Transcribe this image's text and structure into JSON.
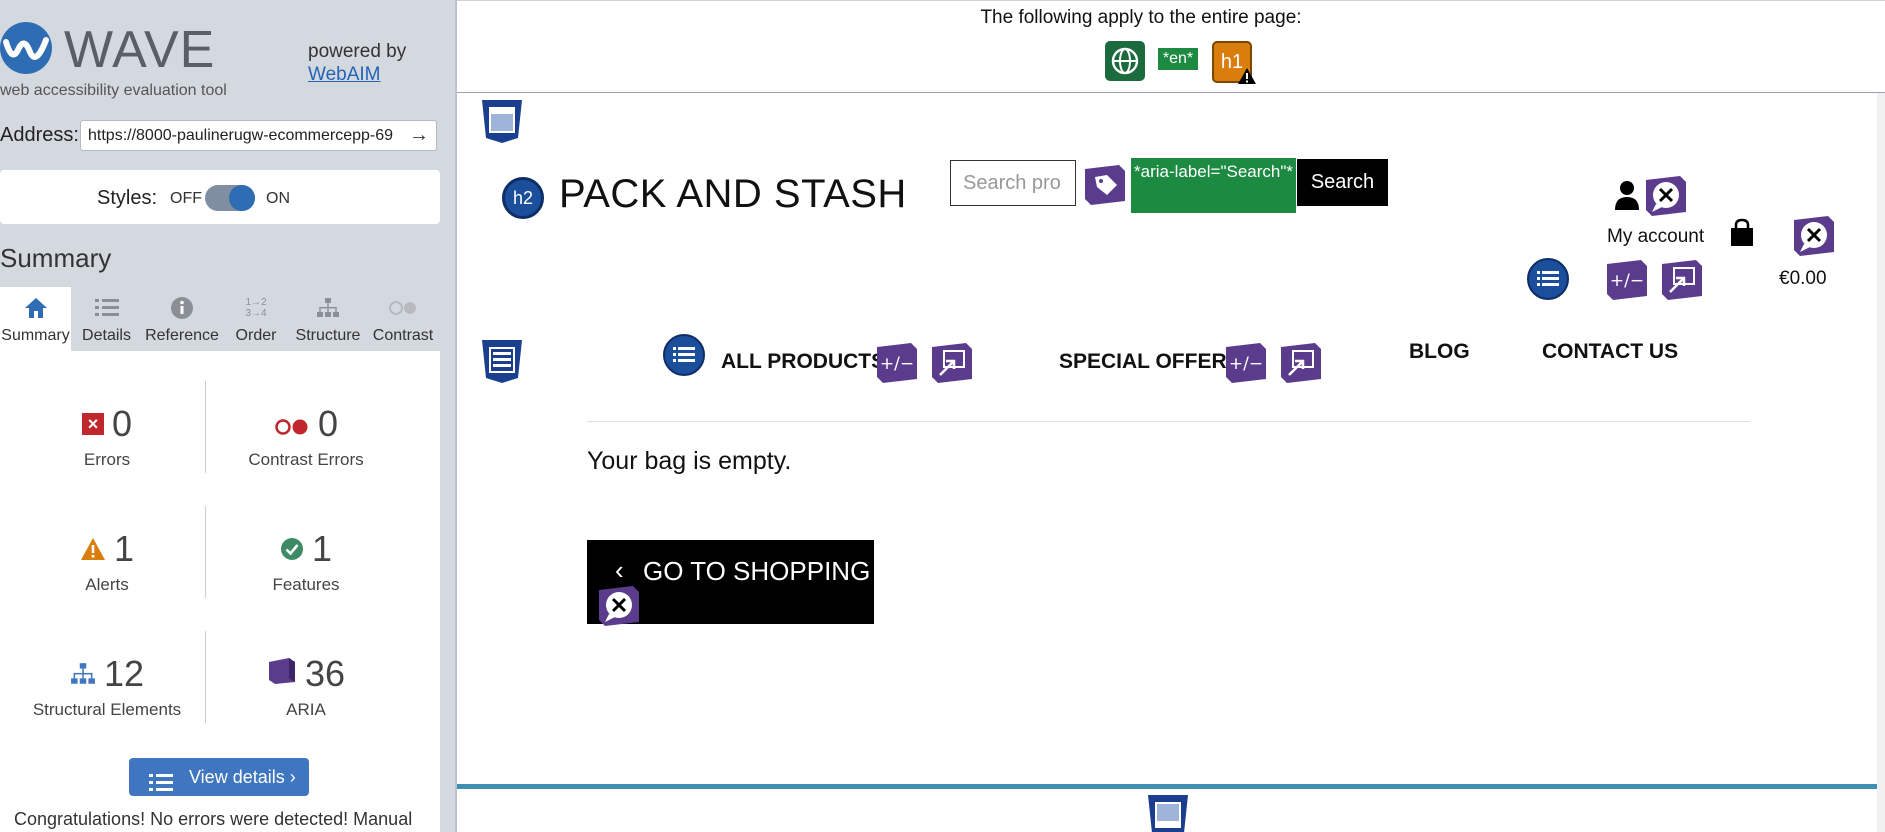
{
  "wave": {
    "logo_text": "WAVE",
    "tagline": "web accessibility evaluation tool",
    "powered_by": "powered by",
    "powered_link": "WebAIM",
    "address_label": "Address:",
    "address_value": "https://8000-paulinerugw-ecommercepp-69",
    "styles_label": "Styles:",
    "styles_off": "OFF",
    "styles_on": "ON",
    "summary_heading": "Summary",
    "tabs": [
      {
        "label": "Summary",
        "icon": "home-icon"
      },
      {
        "label": "Details",
        "icon": "list-icon"
      },
      {
        "label": "Reference",
        "icon": "info-icon"
      },
      {
        "label": "Order",
        "icon": "order-icon"
      },
      {
        "label": "Structure",
        "icon": "structure-icon"
      },
      {
        "label": "Contrast",
        "icon": "contrast-icon"
      }
    ],
    "stats": {
      "errors": {
        "count": "0",
        "label": "Errors"
      },
      "contrast": {
        "count": "0",
        "label": "Contrast Errors"
      },
      "alerts": {
        "count": "1",
        "label": "Alerts"
      },
      "features": {
        "count": "1",
        "label": "Features"
      },
      "structural": {
        "count": "12",
        "label": "Structural Elements"
      },
      "aria": {
        "count": "36",
        "label": "ARIA"
      }
    },
    "view_details": "View details ›",
    "congrats": "Congratulations! No errors were detected! Manual"
  },
  "page_banner": {
    "title": "The following apply to the entire page:",
    "lang_badge": "*en*",
    "h1_badge": "h1"
  },
  "site": {
    "h2_badge": "h2",
    "brand": "PACK AND STASH",
    "search_placeholder": "Search pro",
    "aria_note": "*aria-label=\"Search\"*",
    "search_button": "Search",
    "my_account": "My account",
    "bag_total": "€0.00",
    "nav": {
      "all_products": "ALL PRODUCTS",
      "special_offers": "SPECIAL OFFERS",
      "blog": "BLOG",
      "contact": "CONTACT US"
    },
    "bag_empty": "Your bag is empty.",
    "go_shopping": "GO TO SHOPPING",
    "aria_toggle": "+/−"
  },
  "colors": {
    "wave_blue": "#2e6db4",
    "aria_purple": "#5b3c8c",
    "feature_green": "#1c8a41",
    "alert_orange": "#d97d0d",
    "error_red": "#c0272d"
  }
}
